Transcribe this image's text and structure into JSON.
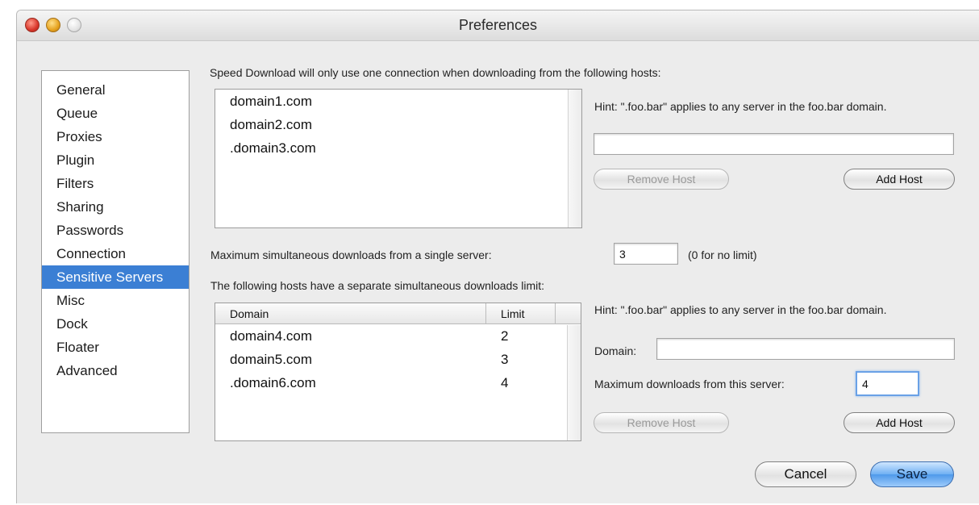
{
  "window": {
    "title": "Preferences"
  },
  "sidebar": {
    "items": [
      {
        "label": "General",
        "selected": false
      },
      {
        "label": "Queue",
        "selected": false
      },
      {
        "label": "Proxies",
        "selected": false
      },
      {
        "label": "Plugin",
        "selected": false
      },
      {
        "label": "Filters",
        "selected": false
      },
      {
        "label": "Sharing",
        "selected": false
      },
      {
        "label": "Passwords",
        "selected": false
      },
      {
        "label": "Connection",
        "selected": false
      },
      {
        "label": "Sensitive Servers",
        "selected": true
      },
      {
        "label": "Misc",
        "selected": false
      },
      {
        "label": "Dock",
        "selected": false
      },
      {
        "label": "Floater",
        "selected": false
      },
      {
        "label": "Advanced",
        "selected": false
      }
    ]
  },
  "single_connection": {
    "description": "Speed Download will only use one connection when downloading from the following hosts:",
    "hosts": [
      "domain1.com",
      "domain2.com",
      ".domain3.com"
    ],
    "hint": "Hint: \".foo.bar\" applies to any server in the foo.bar domain.",
    "host_value": "",
    "remove_label": "Remove Host",
    "add_label": "Add Host"
  },
  "max_simultaneous": {
    "label": "Maximum simultaneous downloads from a single server:",
    "value": "3",
    "note": "(0 for no limit)"
  },
  "separate_limits": {
    "description": "The following hosts have a separate simultaneous downloads limit:",
    "columns": {
      "domain": "Domain",
      "limit": "Limit"
    },
    "rows": [
      {
        "domain": "domain4.com",
        "limit": "2"
      },
      {
        "domain": "domain5.com",
        "limit": "3"
      },
      {
        "domain": ".domain6.com",
        "limit": "4"
      }
    ],
    "hint": "Hint: \".foo.bar\" applies to any server in the foo.bar domain.",
    "domain_label": "Domain:",
    "domain_value": "",
    "max_label": "Maximum downloads from this server:",
    "max_value": "4",
    "remove_label": "Remove Host",
    "add_label": "Add Host"
  },
  "footer": {
    "cancel_label": "Cancel",
    "save_label": "Save"
  }
}
